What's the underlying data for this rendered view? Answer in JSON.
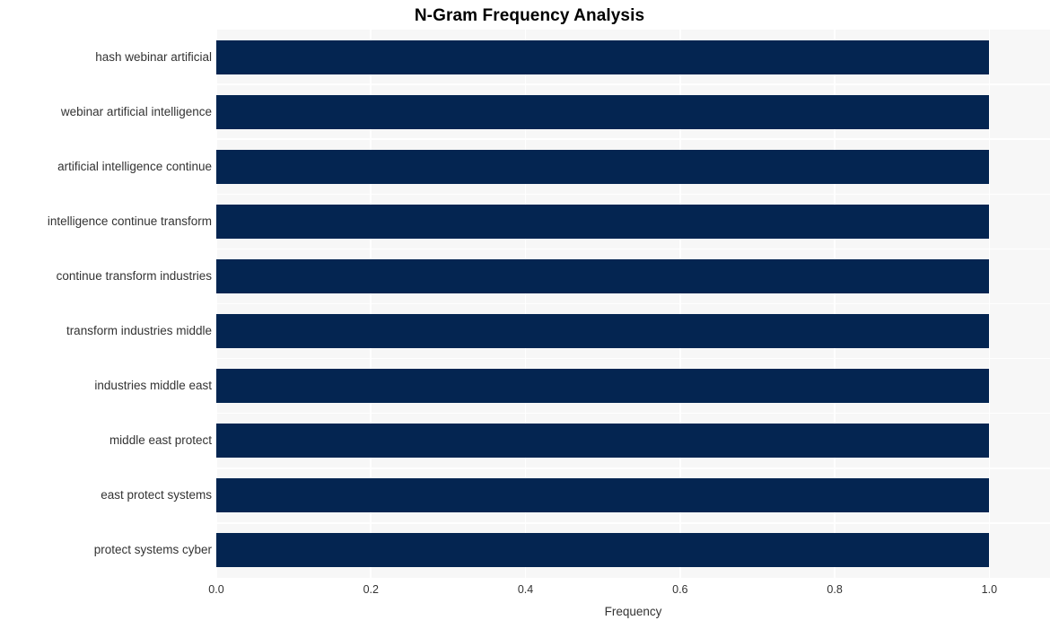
{
  "chart_data": {
    "type": "bar",
    "orientation": "horizontal",
    "title": "N-Gram Frequency Analysis",
    "xlabel": "Frequency",
    "ylabel": "",
    "categories": [
      "hash webinar artificial",
      "webinar artificial intelligence",
      "artificial intelligence continue",
      "intelligence continue transform",
      "continue transform industries",
      "transform industries middle",
      "industries middle east",
      "middle east protect",
      "east protect systems",
      "protect systems cyber"
    ],
    "values": [
      1.0,
      1.0,
      1.0,
      1.0,
      1.0,
      1.0,
      1.0,
      1.0,
      1.0,
      1.0
    ],
    "xticks": [
      "0.0",
      "0.2",
      "0.4",
      "0.6",
      "0.8",
      "1.0"
    ],
    "xtick_values": [
      0.0,
      0.2,
      0.4,
      0.6,
      0.8,
      1.0
    ],
    "xlim": [
      0.0,
      1.0785
    ],
    "grid": true,
    "legend": "none",
    "bar_color": "#042551",
    "plot_background": "#f7f7f7",
    "figure_background": "#ffffff",
    "grid_color": "#ffffff",
    "text_color": "#333333",
    "title_color": "#000000"
  }
}
